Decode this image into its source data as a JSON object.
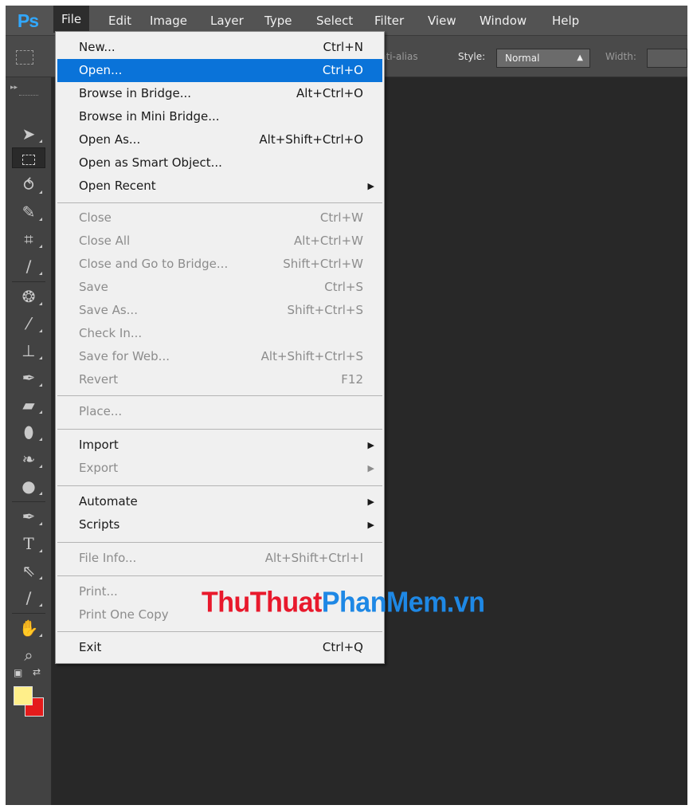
{
  "app": {
    "logo": "Ps"
  },
  "menubar": {
    "items": [
      "File",
      "Edit",
      "Image",
      "Layer",
      "Type",
      "Select",
      "Filter",
      "View",
      "Window",
      "Help"
    ],
    "active": "File"
  },
  "options_bar": {
    "anti_alias": "nti-alias",
    "style_label": "Style:",
    "style_value": "Normal",
    "width_label": "Width:"
  },
  "toolbar": {
    "tools": [
      "move-icon",
      "rectangular-marquee-icon",
      "lasso-icon",
      "quick-selection-icon",
      "crop-icon",
      "eyedropper-icon",
      "spot-healing-icon",
      "brush-icon",
      "clone-stamp-icon",
      "history-brush-icon",
      "eraser-icon",
      "paint-bucket-icon",
      "blur-icon",
      "dodge-icon",
      "pen-icon",
      "type-icon",
      "path-selection-icon",
      "line-icon",
      "hand-icon",
      "zoom-icon"
    ],
    "foreground_color": "#ffef8a",
    "background_color": "#e41b1b"
  },
  "file_menu": {
    "new": {
      "label": "New...",
      "shortcut": "Ctrl+N"
    },
    "open": {
      "label": "Open...",
      "shortcut": "Ctrl+O"
    },
    "browse_bridge": {
      "label": "Browse in Bridge...",
      "shortcut": "Alt+Ctrl+O"
    },
    "browse_mini_bridge": {
      "label": "Browse in Mini Bridge...",
      "shortcut": ""
    },
    "open_as": {
      "label": "Open As...",
      "shortcut": "Alt+Shift+Ctrl+O"
    },
    "open_smart_object": {
      "label": "Open as Smart Object...",
      "shortcut": ""
    },
    "open_recent": {
      "label": "Open Recent",
      "shortcut": ""
    },
    "close": {
      "label": "Close",
      "shortcut": "Ctrl+W"
    },
    "close_all": {
      "label": "Close All",
      "shortcut": "Alt+Ctrl+W"
    },
    "close_go_bridge": {
      "label": "Close and Go to Bridge...",
      "shortcut": "Shift+Ctrl+W"
    },
    "save": {
      "label": "Save",
      "shortcut": "Ctrl+S"
    },
    "save_as": {
      "label": "Save As...",
      "shortcut": "Shift+Ctrl+S"
    },
    "check_in": {
      "label": "Check In...",
      "shortcut": ""
    },
    "save_for_web": {
      "label": "Save for Web...",
      "shortcut": "Alt+Shift+Ctrl+S"
    },
    "revert": {
      "label": "Revert",
      "shortcut": "F12"
    },
    "place": {
      "label": "Place...",
      "shortcut": ""
    },
    "import": {
      "label": "Import",
      "shortcut": ""
    },
    "export": {
      "label": "Export",
      "shortcut": ""
    },
    "automate": {
      "label": "Automate",
      "shortcut": ""
    },
    "scripts": {
      "label": "Scripts",
      "shortcut": ""
    },
    "file_info": {
      "label": "File Info...",
      "shortcut": "Alt+Shift+Ctrl+I"
    },
    "print": {
      "label": "Print...",
      "shortcut": ""
    },
    "print_one_copy": {
      "label": "Print One Copy",
      "shortcut": ""
    },
    "exit": {
      "label": "Exit",
      "shortcut": "Ctrl+Q"
    }
  },
  "watermark": {
    "red": "ThuThuat",
    "blue": "PhanMem.vn"
  },
  "colors": {
    "highlight": "#0a73d9",
    "menu_bg": "#f0f0f0",
    "workspace": "#282828",
    "logo": "#31a8ff"
  }
}
